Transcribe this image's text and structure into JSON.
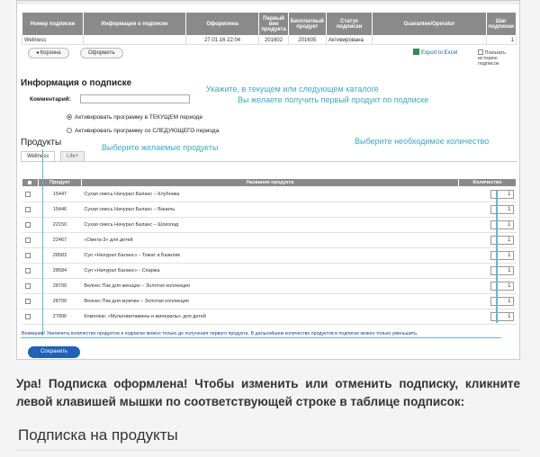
{
  "subs_table": {
    "headers": [
      "Номер подписки",
      "Информация о подписке",
      "Оформлена",
      "Первый вин продукта",
      "Бесплатный продукт",
      "Статус подписки",
      "Guarantee/Operator",
      "Шаг подписки"
    ],
    "row": [
      "Wellness",
      "",
      "27.01.16 22:04",
      "201602",
      "201605",
      "Активирована",
      "",
      "1"
    ]
  },
  "buttons": {
    "cart": "Корзина",
    "checkout": "Оформить"
  },
  "export_label": "Export to Excel",
  "history_label": "Показать историю подписок",
  "info": {
    "heading": "Информация о подписке",
    "comment_label": "Комментарий:",
    "radio_current": "Активировать программу в ТЕКУЩЕМ периоде",
    "radio_next": "Активировать программу со СЛЕДУЮЩЕГО периода"
  },
  "annotations": {
    "catalog_line1": "Укажите, в текущем или следующем каталоге",
    "catalog_line2": "Вы желаете получить первый продукт по подписке",
    "choose_products": "Выберите желаемые продукты",
    "choose_qty": "Выберите необходимое количество"
  },
  "products": {
    "heading": "Продукты",
    "tabs": [
      "Wellness",
      "Life+"
    ],
    "headers": [
      "Продукт",
      "Название продукта",
      "Количество"
    ],
    "rows": [
      {
        "id": "15447",
        "name": "Сухая смесь Начурал Баланс – Клубника",
        "qty": "1"
      },
      {
        "id": "15446",
        "name": "Сухая смесь Начурал Баланс – Ваниль",
        "qty": "1"
      },
      {
        "id": "22150",
        "name": "Сухая смесь Начурал Баланс – Шоколад",
        "qty": "1"
      },
      {
        "id": "22467",
        "name": "«Омега-3» для детей",
        "qty": "1"
      },
      {
        "id": "28583",
        "name": "Суп «Начурал Баланс» - Томат и Базилик",
        "qty": "1"
      },
      {
        "id": "28584",
        "name": "Суп «Начурал Баланс» - Спаржа",
        "qty": "1"
      },
      {
        "id": "28700",
        "name": "Велнес Пак для женщин – Золотая коллекция",
        "qty": "1"
      },
      {
        "id": "28700",
        "name": "Велнес Пак для мужчин – Золотая коллекция",
        "qty": "1"
      },
      {
        "id": "27896",
        "name": "Комплекс «Мультивитамины и минералы» для детей",
        "qty": "1"
      }
    ],
    "warning": "Внимание! Увеличить количество продуктов в подписке можно только до получения первого продукта. В дальнейшем количество продуктов в подписке можно только уменьшить."
  },
  "submit_label": "Сохранить",
  "paragraph": "Ура! Подписка оформлена! Чтобы изменить или отменить подписку, кликните левой клавишей мышки по соответствующей строке в таблице подписок:",
  "section_title": "Подписка на продукты",
  "colors": {
    "annotation": "#3aa8c8",
    "header_gray": "#8a8a8a",
    "link_blue": "#1f5fa8"
  }
}
